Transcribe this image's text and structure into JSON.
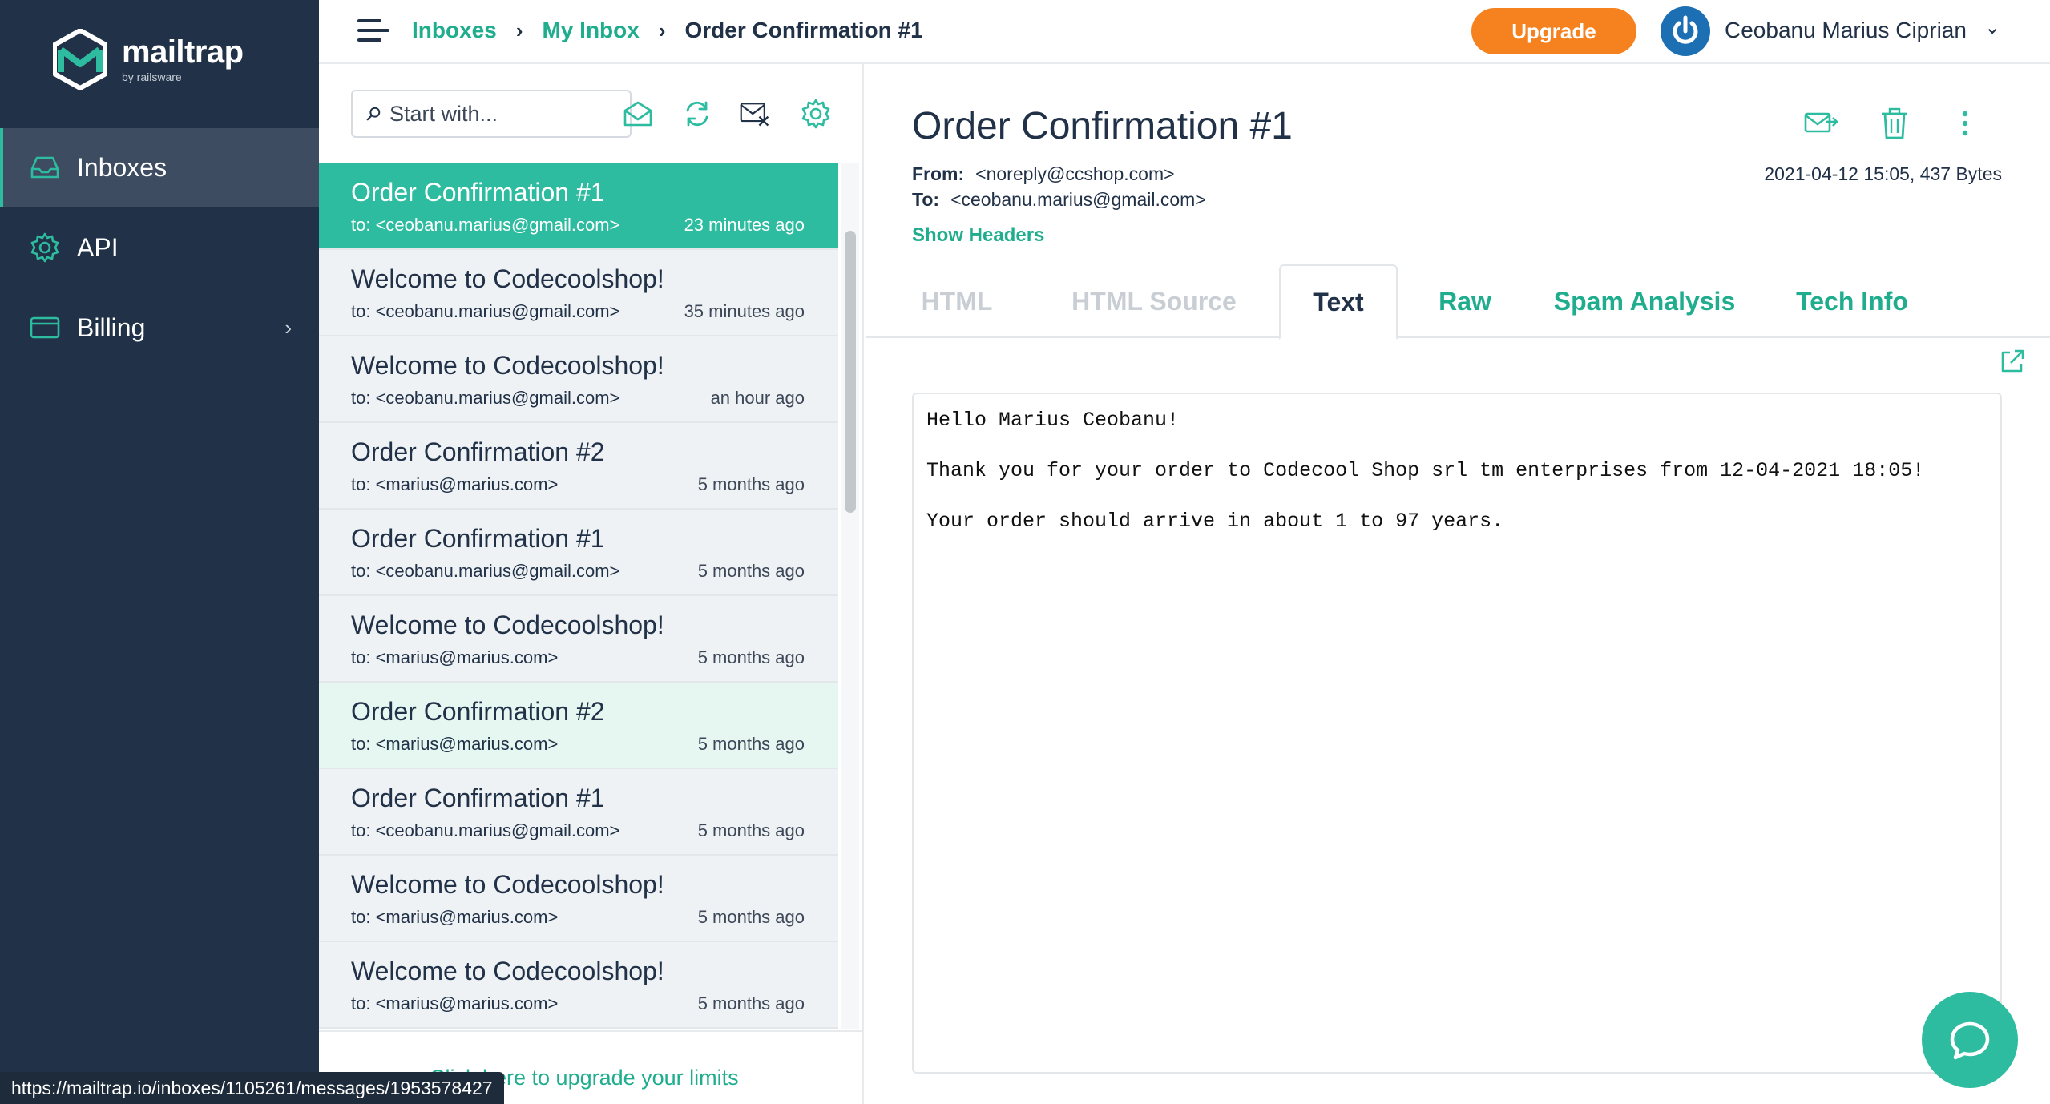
{
  "brand": {
    "name": "mailtrap",
    "sub": "by railsware",
    "accent": "#2ebca0",
    "sidebar_bg": "#213147"
  },
  "sidebar": {
    "items": [
      {
        "label": "Inboxes",
        "icon": "inbox-icon",
        "active": true
      },
      {
        "label": "API",
        "icon": "gear-icon"
      },
      {
        "label": "Billing",
        "icon": "credit-card-icon",
        "chevron": "›"
      }
    ]
  },
  "topbar": {
    "breadcrumbs": [
      "Inboxes",
      "My Inbox",
      "Order Confirmation #1"
    ],
    "separator": "›",
    "upgrade_label": "Upgrade",
    "upgrade_color": "#f5821f",
    "user_name": "Ceobanu Marius Ciprian",
    "user_chevron": "⌄"
  },
  "list": {
    "search_placeholder": "Start with...",
    "toolbar": [
      "open-envelope-icon",
      "refresh-icon",
      "clear-inbox-icon",
      "settings-icon"
    ],
    "messages": [
      {
        "subject": "Order Confirmation #1",
        "to": "to: <ceobanu.marius@gmail.com>",
        "time": "23 minutes ago"
      },
      {
        "subject": "Welcome to Codecoolshop!",
        "to": "to: <ceobanu.marius@gmail.com>",
        "time": "35 minutes ago"
      },
      {
        "subject": "Welcome to Codecoolshop!",
        "to": "to: <ceobanu.marius@gmail.com>",
        "time": "an hour ago"
      },
      {
        "subject": "Order Confirmation #2",
        "to": "to: <marius@marius.com>",
        "time": "5 months ago"
      },
      {
        "subject": "Order Confirmation #1",
        "to": "to: <ceobanu.marius@gmail.com>",
        "time": "5 months ago"
      },
      {
        "subject": "Welcome to Codecoolshop!",
        "to": "to: <marius@marius.com>",
        "time": "5 months ago"
      },
      {
        "subject": "Order Confirmation #2",
        "to": "to: <marius@marius.com>",
        "time": "5 months ago"
      },
      {
        "subject": "Order Confirmation #1",
        "to": "to: <ceobanu.marius@gmail.com>",
        "time": "5 months ago"
      },
      {
        "subject": "Welcome to Codecoolshop!",
        "to": "to: <marius@marius.com>",
        "time": "5 months ago"
      },
      {
        "subject": "Welcome to Codecoolshop!",
        "to": "to: <marius@marius.com>",
        "time": "5 months ago"
      }
    ],
    "upgrade_link": "Click here to upgrade your limits"
  },
  "viewer": {
    "title": "Order Confirmation #1",
    "from_label": "From:",
    "from": "<noreply@ccshop.com>",
    "to_label": "To:",
    "to": "<ceobanu.marius@gmail.com>",
    "meta": "2021-04-12 15:05, 437 Bytes",
    "show_headers": "Show Headers",
    "actions": [
      "forward-icon",
      "trash-icon",
      "more-vertical-icon"
    ],
    "tabs": [
      "HTML",
      "HTML Source",
      "Text",
      "Raw",
      "Spam Analysis",
      "Tech Info"
    ],
    "active_tab": "Text",
    "body_lines": [
      "Hello Marius Ceobanu!",
      "Thank you for your order to Codecool Shop srl tm enterprises from 12-04-2021 18:05!",
      "Your order should arrive in about 1 to 97 years."
    ]
  },
  "status_url": "https://mailtrap.io/inboxes/1105261/messages/1953578427"
}
